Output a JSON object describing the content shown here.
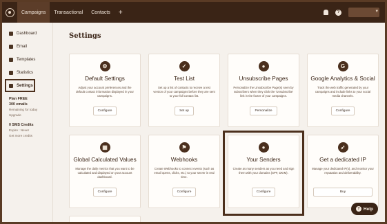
{
  "topbar": {
    "nav": [
      "Campaigns",
      "Transactional",
      "Contacts"
    ],
    "plus": "+"
  },
  "sidebar": {
    "items": [
      {
        "label": "Dashboard",
        "icon": "home-icon"
      },
      {
        "label": "Email",
        "icon": "mail-icon"
      },
      {
        "label": "Templates",
        "icon": "template-icon"
      },
      {
        "label": "Statistics",
        "icon": "chart-icon"
      },
      {
        "label": "Settings",
        "icon": "gear-icon"
      }
    ],
    "plan": {
      "title": "Plan FREE",
      "emails": "300 emails",
      "remaining": "Remaining for today",
      "upgrade": "Upgrade"
    },
    "sms": {
      "title": "0 SMS Credits",
      "expire": "Expire : Never",
      "get_more": "Get more credits"
    }
  },
  "main": {
    "title": "Settings",
    "cards": [
      {
        "title": "Default Settings",
        "icon": "gear-icon",
        "desc": "Adjust your account preferences and the default contact information displayed in your campaigns.",
        "button": "Configure"
      },
      {
        "title": "Test List",
        "icon": "checklist-icon",
        "desc": "Set up a list of contacts to receive a test version of your campaigns before they are sent to your full contact list.",
        "button": "Set up"
      },
      {
        "title": "Unsubscribe Pages",
        "icon": "unsubscribe-icon",
        "desc": "Personalize the Unsubscribe Page(s) seen by subscribers when they click the 'Unsubscribe' link in the footer of your campaigns.",
        "button": "Personalize"
      },
      {
        "title": "Google Analytics & Social",
        "icon": "google-icon",
        "desc": "Track the web traffic generated by your campaigns and include links to your social media channels.",
        "button": "Configure"
      },
      {
        "title": "Global Calculated Values",
        "icon": "calculator-icon",
        "desc": "Manage the daily metrics that you want to be calculated and displayed on your account dashboard.",
        "button": "Configure"
      },
      {
        "title": "Webhooks",
        "icon": "webhook-icon",
        "desc": "Create Webhooks to connect events (such as email opens, clicks, etc.) to your server in real time.",
        "button": "Configure"
      },
      {
        "title": "Your Senders",
        "icon": "user-icon",
        "desc": "Create as many senders as you need and sign them with your domains (SPF, DKIM).",
        "button": "Configure"
      },
      {
        "title": "Get a dedicated IP",
        "icon": "rocket-icon",
        "desc": "Manage your dedicated IP(s), and monitor your reputation and deliverability.",
        "button": "Buy"
      }
    ]
  },
  "help": {
    "label": "Help"
  }
}
